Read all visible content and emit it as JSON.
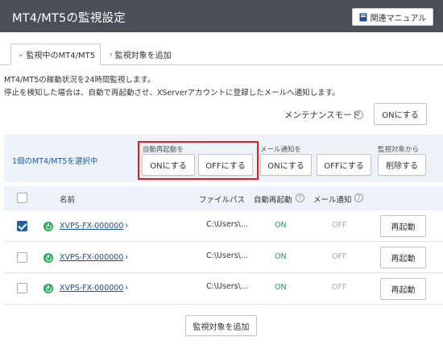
{
  "header": {
    "title": "MT4/MT5の監視設定",
    "manual_button": "関連マニュアル",
    "manual_icon": "book-icon",
    "bg_color": "#4a4f57"
  },
  "tabs": [
    {
      "label": "監視中のMT4/MT5",
      "active": true,
      "icon": "chevron-down-icon"
    },
    {
      "label": "監視対象を追加",
      "active": false,
      "icon": "chevron-right-icon"
    }
  ],
  "description": {
    "line1": "MT4/MT5の稼動状況を24時間監視します。",
    "line2": "停止を検知した場合は、自動で再起動させ、XServerアカウントに登録したメールへ通知します。"
  },
  "maintenance": {
    "label": "メンテナンスモード",
    "button": "ONにする"
  },
  "bulk": {
    "selected_text": "1個のMT4/MT5を選択中",
    "auto_restart": {
      "label": "自動再起動を",
      "on": "ONにする",
      "off": "OFFにする"
    },
    "mail": {
      "label": "メール通知を",
      "on": "ONにする",
      "off": "OFFにする"
    },
    "remove": {
      "label": "監視対象から",
      "button": "削除する"
    },
    "highlight_color": "#e01d24"
  },
  "table": {
    "headers": {
      "name": "名前",
      "path": "ファイルパス",
      "auto_restart": "自動再起動",
      "mail": "メール通知"
    },
    "rows": [
      {
        "checked": true,
        "name": "XVPS-FX-000000",
        "path": "C:\\Users\\...",
        "auto_restart": "ON",
        "mail": "OFF",
        "action": "再起動"
      },
      {
        "checked": false,
        "name": "XVPS-FX-000000",
        "path": "C:\\Users\\...",
        "auto_restart": "ON",
        "mail": "OFF",
        "action": "再起動"
      },
      {
        "checked": false,
        "name": "XVPS-FX-000000",
        "path": "C:\\Users\\...",
        "auto_restart": "ON",
        "mail": "OFF",
        "action": "再起動"
      }
    ]
  },
  "add_button": "監視対象を追加",
  "colors": {
    "accent": "#1f5fa8",
    "on": "#2d9c4e",
    "off": "#aaaaaa",
    "panel": "#eef2f9"
  }
}
